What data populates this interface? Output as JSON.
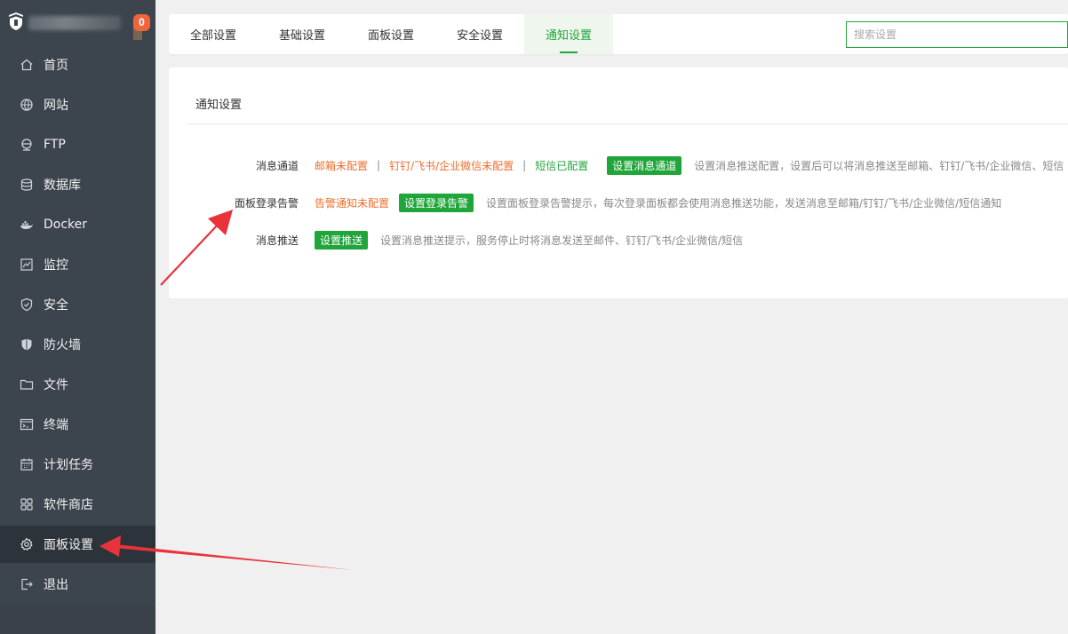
{
  "sidebar": {
    "badge_count": "0",
    "items": [
      {
        "label": "首页",
        "icon": "home-icon"
      },
      {
        "label": "网站",
        "icon": "globe-icon"
      },
      {
        "label": "FTP",
        "icon": "ftp-icon"
      },
      {
        "label": "数据库",
        "icon": "database-icon"
      },
      {
        "label": "Docker",
        "icon": "docker-icon"
      },
      {
        "label": "监控",
        "icon": "monitor-icon"
      },
      {
        "label": "安全",
        "icon": "shield-check-icon"
      },
      {
        "label": "防火墙",
        "icon": "firewall-shield-icon"
      },
      {
        "label": "文件",
        "icon": "folder-icon"
      },
      {
        "label": "终端",
        "icon": "terminal-icon"
      },
      {
        "label": "计划任务",
        "icon": "calendar-icon"
      },
      {
        "label": "软件商店",
        "icon": "apps-grid-icon"
      },
      {
        "label": "面板设置",
        "icon": "gear-icon",
        "active": true
      },
      {
        "label": "退出",
        "icon": "logout-icon"
      }
    ]
  },
  "tabs": [
    {
      "label": "全部设置"
    },
    {
      "label": "基础设置"
    },
    {
      "label": "面板设置"
    },
    {
      "label": "安全设置"
    },
    {
      "label": "通知设置",
      "active": true
    }
  ],
  "search": {
    "placeholder": "搜索设置"
  },
  "panel": {
    "title": "通知设置",
    "rows": {
      "channel": {
        "label": "消息通道",
        "email_status": "邮箱未配置",
        "im_status": "钉钉/飞书/企业微信未配置",
        "sms_status": "短信已配置",
        "separator": "|",
        "button": "设置消息通道",
        "desc": "设置消息推送配置，设置后可以将消息推送至邮箱、钉钉/飞书/企业微信、短信"
      },
      "login_alert": {
        "label": "面板登录告警",
        "status": "告警通知未配置",
        "button": "设置登录告警",
        "desc": "设置面板登录告警提示，每次登录面板都会使用消息推送功能，发送消息至邮箱/钉钉/飞书/企业微信/短信通知"
      },
      "push": {
        "label": "消息推送",
        "button": "设置推送",
        "desc": "设置消息推送提示，服务停止时将消息发送至邮件、钉钉/飞书/企业微信/短信"
      }
    }
  },
  "colors": {
    "accent_green": "#20a53a",
    "warning_orange": "#ee6e2e",
    "sidebar_bg": "#3c444d",
    "annotation_red": "#e8333a"
  }
}
